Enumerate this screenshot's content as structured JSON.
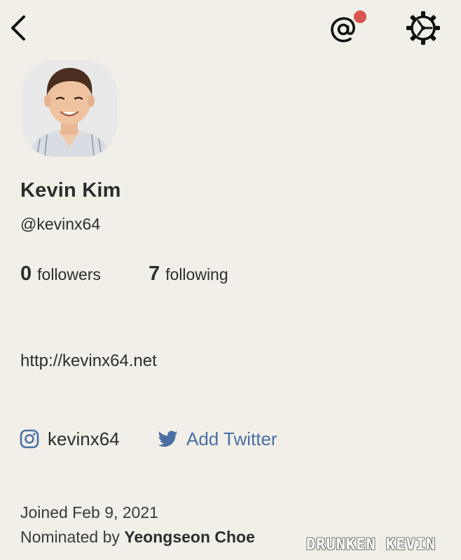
{
  "header": {
    "back_icon": "chevron-left-icon",
    "mention_icon": "at-sign-icon",
    "settings_icon": "gear-icon",
    "notification_dot_color": "#d9534f"
  },
  "profile": {
    "name": "Kevin Kim",
    "username": "@kevinx64",
    "followers_count": "0",
    "followers_label": "followers",
    "following_count": "7",
    "following_label": "following",
    "website": "http://kevinx64.net",
    "instagram_handle": "kevinx64",
    "twitter_action": "Add Twitter",
    "joined": "Joined Feb 9, 2021",
    "nominated_prefix": "Nominated by ",
    "nominated_by": "Yeongseon Choe"
  },
  "colors": {
    "background": "#f1efe7",
    "text": "#2d2d2d",
    "twitter_link": "#4a6fa5"
  },
  "watermark": "DRUNKEN KEVIN"
}
